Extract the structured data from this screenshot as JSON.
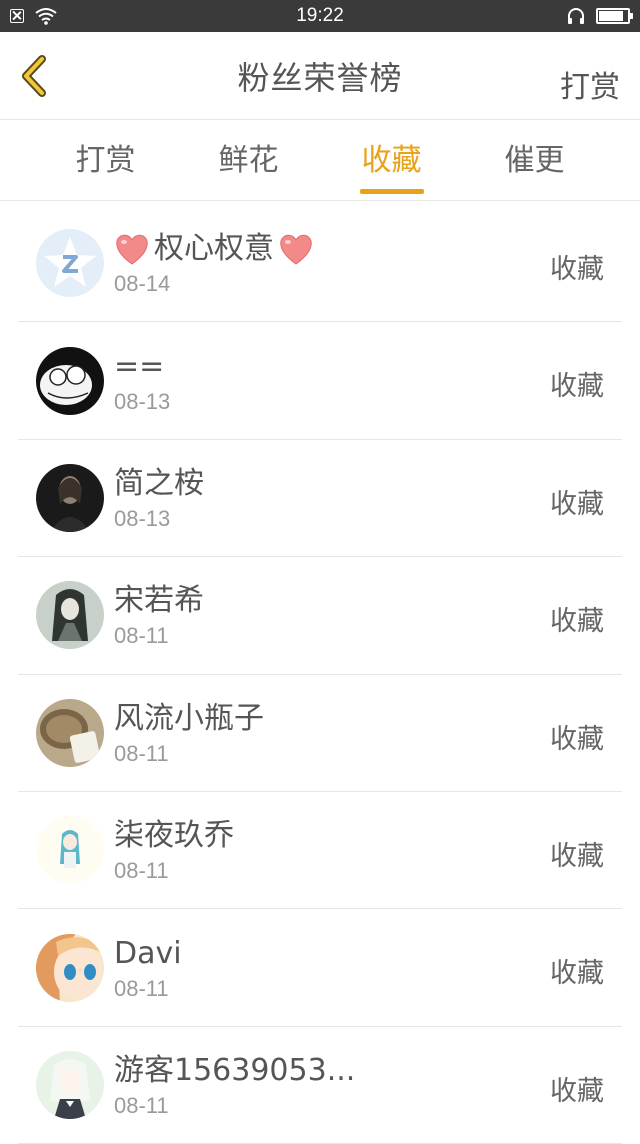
{
  "status_bar": {
    "time": "19:22"
  },
  "header": {
    "title": "粉丝荣誉榜",
    "right_action": "打赏"
  },
  "tabs": [
    {
      "label": "打赏",
      "active": false
    },
    {
      "label": "鲜花",
      "active": false
    },
    {
      "label": "收藏",
      "active": true
    },
    {
      "label": "催更",
      "active": false
    }
  ],
  "accent_color": "#e9a219",
  "list": [
    {
      "name": "权心权意",
      "date": "08-14",
      "action": "收藏",
      "hearts": true
    },
    {
      "name": "==",
      "date": "08-13",
      "action": "收藏"
    },
    {
      "name": "简之桉",
      "date": "08-13",
      "action": "收藏"
    },
    {
      "name": "宋若希",
      "date": "08-11",
      "action": "收藏"
    },
    {
      "name": "风流小瓶子",
      "date": "08-11",
      "action": "收藏"
    },
    {
      "name": "柒夜玖乔",
      "date": "08-11",
      "action": "收藏"
    },
    {
      "name": "Davi",
      "date": "08-11",
      "action": "收藏"
    },
    {
      "name": "游客15639053...",
      "date": "08-11",
      "action": "收藏"
    }
  ]
}
